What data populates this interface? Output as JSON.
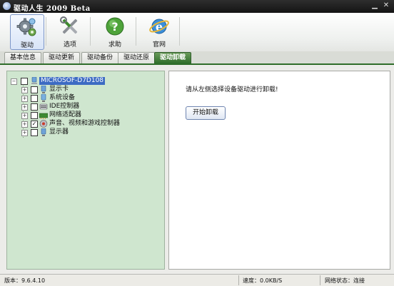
{
  "window": {
    "title": "驱动人生 2009 Beta",
    "min_glyph": "▁",
    "close_glyph": "✕"
  },
  "toolbar": {
    "items": [
      {
        "label": "驱动",
        "icon": "gear-icon",
        "active": true
      },
      {
        "label": "选项",
        "icon": "tools-icon",
        "active": false
      },
      {
        "label": "求助",
        "icon": "help-icon",
        "active": false
      },
      {
        "label": "官网",
        "icon": "ie-globe-icon",
        "active": false
      }
    ]
  },
  "tabs": [
    {
      "label": "基本信息",
      "active": false
    },
    {
      "label": "驱动更新",
      "active": false
    },
    {
      "label": "驱动备份",
      "active": false
    },
    {
      "label": "驱动还原",
      "active": false
    },
    {
      "label": "驱动卸载",
      "active": true
    }
  ],
  "tree": {
    "root": {
      "label": "MICROSOF-D7D108",
      "checked": false
    },
    "children": [
      {
        "label": "显示卡",
        "checked": false,
        "icon": "display-card-icon"
      },
      {
        "label": "系统设备",
        "checked": false,
        "icon": "system-device-icon"
      },
      {
        "label": "IDE控制器",
        "checked": false,
        "icon": "ide-controller-icon"
      },
      {
        "label": "网络适配器",
        "checked": false,
        "icon": "network-adapter-icon"
      },
      {
        "label": "声音、视频和游戏控制器",
        "checked": true,
        "icon": "sound-icon"
      },
      {
        "label": "显示器",
        "checked": false,
        "icon": "monitor-icon"
      }
    ],
    "expander_glyph": "+",
    "check_glyph": "✓"
  },
  "right_panel": {
    "prompt": "请从左侧选择设备驱动进行卸载!",
    "start_button": "开始卸载"
  },
  "status": {
    "version": "版本：9.6.4.10",
    "speed": "速度：0.0KB/S",
    "network": "网络状态：连接"
  },
  "colors": {
    "active_tab": "#2f6d2a",
    "tree_bg": "#cfe6cf",
    "selection": "#3d6bc3"
  }
}
